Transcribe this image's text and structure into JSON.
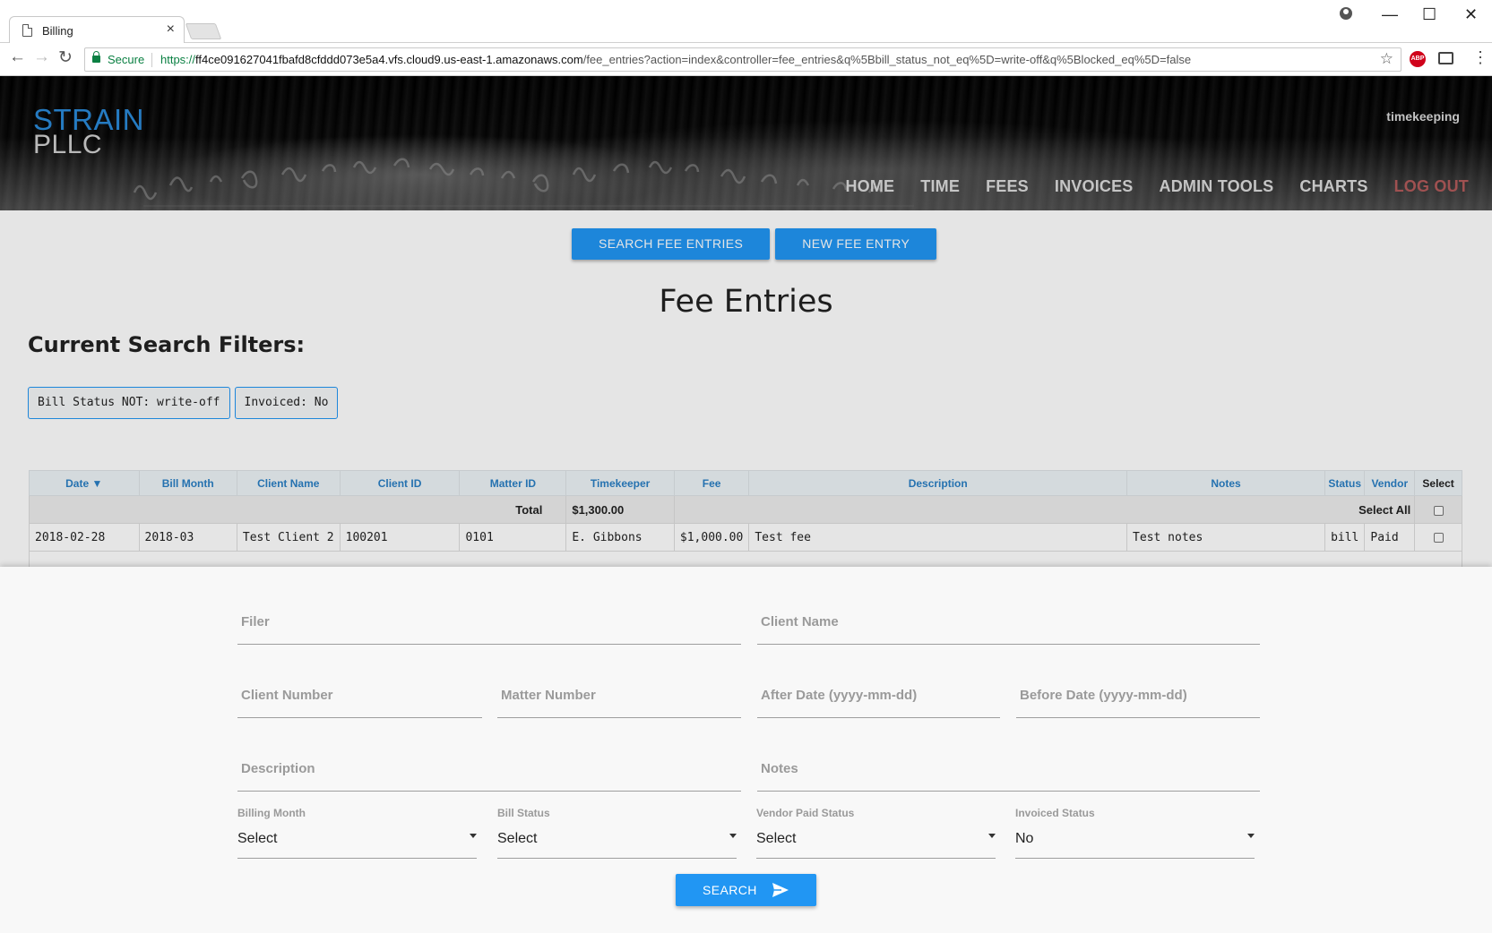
{
  "browser": {
    "tab_title": "Billing",
    "secure_label": "Secure",
    "url_scheme": "https://",
    "url_host": "ff4ce091627041fbafd8cfddd073e5a4.vfs.cloud9.us-east-1.amazonaws.com",
    "url_path": "/fee_entries?action=index&controller=fee_entries&q%5Bbill_status_not_eq%5D=write-off&q%5Blocked_eq%5D=false",
    "abp_label": "ABP"
  },
  "header": {
    "logo_top": "STRAIN",
    "logo_bottom": "PLLC",
    "user": "timekeeping",
    "nav": [
      "HOME",
      "TIME",
      "FEES",
      "INVOICES",
      "ADMIN TOOLS",
      "CHARTS",
      "LOG OUT"
    ]
  },
  "actions": {
    "search_label": "SEARCH FEE ENTRIES",
    "new_label": "NEW FEE ENTRY"
  },
  "page_title": "Fee Entries",
  "filters": {
    "heading": "Current Search Filters:",
    "chips": [
      "Bill Status NOT: write-off",
      "Invoiced: No"
    ]
  },
  "table": {
    "headers": [
      "Date ▼",
      "Bill Month",
      "Client Name",
      "Client ID",
      "Matter ID",
      "Timekeeper",
      "Fee",
      "Description",
      "Notes",
      "Status",
      "Vendor",
      "Select"
    ],
    "total_label": "Total",
    "total_value": "$1,300.00",
    "select_all_label": "Select All",
    "rows": [
      {
        "date": "2018-02-28",
        "bill_month": "2018-03",
        "client_name": "Test Client 2",
        "client_id": "100201",
        "matter_id": "0101",
        "timekeeper": "E. Gibbons",
        "fee": "$1,000.00",
        "description": "Test fee",
        "notes": "Test notes",
        "status": "bill",
        "vendor": "Paid"
      }
    ]
  },
  "search_panel": {
    "filer_placeholder": "Filer",
    "client_name_placeholder": "Client Name",
    "client_number_placeholder": "Client Number",
    "matter_number_placeholder": "Matter Number",
    "after_date_placeholder": "After Date (yyyy-mm-dd)",
    "before_date_placeholder": "Before Date (yyyy-mm-dd)",
    "description_placeholder": "Description",
    "notes_placeholder": "Notes",
    "billing_month": {
      "label": "Billing Month",
      "value": "Select"
    },
    "bill_status": {
      "label": "Bill Status",
      "value": "Select"
    },
    "vendor_paid_status": {
      "label": "Vendor Paid Status",
      "value": "Select"
    },
    "invoiced_status": {
      "label": "Invoiced Status",
      "value": "No"
    },
    "search_button": "SEARCH"
  }
}
